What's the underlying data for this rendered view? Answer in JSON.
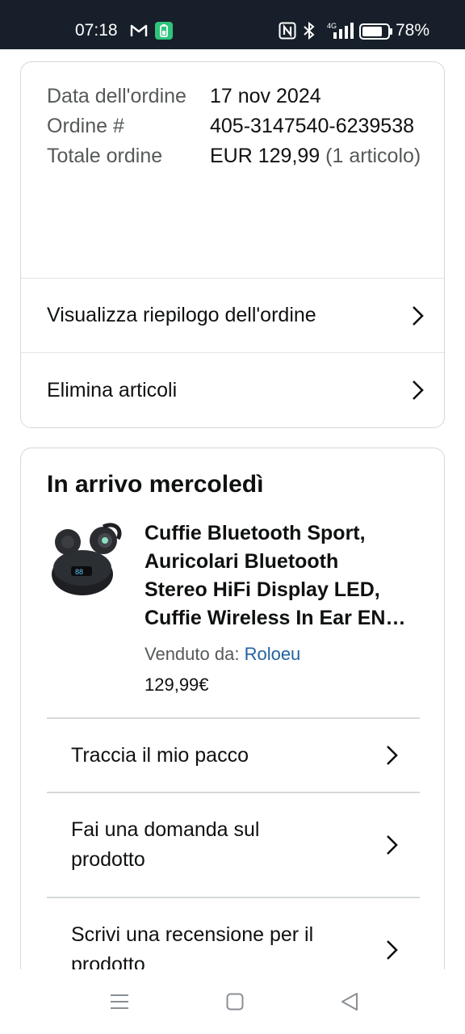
{
  "status_bar": {
    "time": "07:18",
    "battery_percent": "78%",
    "network": "4G"
  },
  "order_summary": {
    "date_label": "Data dell'ordine",
    "date_value": "17 nov 2024",
    "number_label": "Ordine #",
    "number_value": "405-3147540-6239538",
    "total_label": "Totale ordine",
    "total_value": "EUR 129,99",
    "total_items": "(1 articolo)",
    "view_summary_label": "Visualizza riepilogo dell'ordine",
    "delete_items_label": "Elimina articoli"
  },
  "delivery": {
    "title": "In arrivo mercoledì",
    "product": {
      "title_lines": [
        "Cuffie Bluetooth Sport,",
        "Auricolari Bluetooth",
        "Stereo HiFi Display LED,",
        "Cuffie Wireless In Ear EN…"
      ],
      "sold_by_label": "Venduto da:",
      "seller": "Roloeu",
      "price": "129,99€"
    },
    "actions": {
      "track": "Traccia il mio pacco",
      "ask_line1": "Fai una domanda sul",
      "ask_line2": "prodotto",
      "review_line1": "Scrivi una recensione per il",
      "review_line2": "prodotto"
    }
  },
  "icons": {
    "status": [
      "gmail-icon",
      "battery-app-icon",
      "nfc-icon",
      "bluetooth-icon",
      "signal-icon",
      "battery-icon"
    ],
    "nav": [
      "menu-icon",
      "home-icon",
      "back-icon"
    ],
    "row": "chevron-right-icon"
  },
  "colors": {
    "status_bar_bg": "#17202a",
    "seller_link": "#2162a1",
    "muted_text": "#565959",
    "border": "#d5d9d9"
  }
}
